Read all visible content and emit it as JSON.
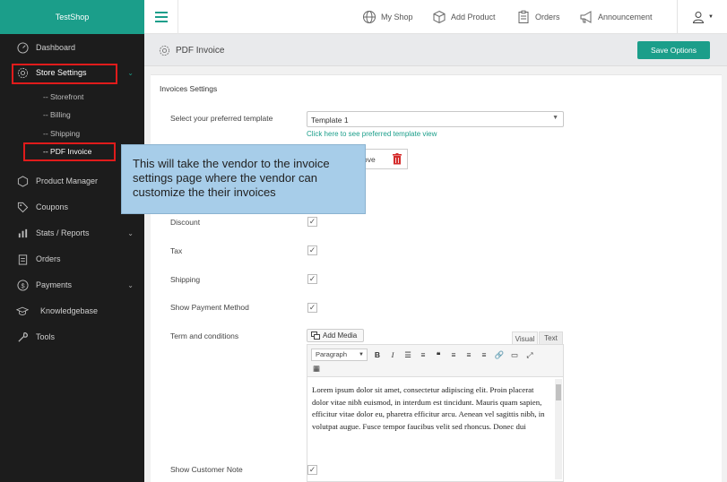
{
  "brand": "TestShop",
  "topnav": [
    {
      "label": "My Shop",
      "icon": "globe-icon"
    },
    {
      "label": "Add Product",
      "icon": "box-icon"
    },
    {
      "label": "Orders",
      "icon": "clipboard-icon"
    },
    {
      "label": "Announcement",
      "icon": "megaphone-icon"
    }
  ],
  "sidebar": {
    "items": [
      {
        "label": "Dashboard",
        "icon": "dashboard-icon"
      },
      {
        "label": "Store Settings",
        "icon": "gear-icon"
      },
      {
        "label": "Product Manager",
        "icon": "cube-icon"
      },
      {
        "label": "Coupons",
        "icon": "tag-icon"
      },
      {
        "label": "Stats / Reports",
        "icon": "chart-icon"
      },
      {
        "label": "Orders",
        "icon": "clipboard-icon"
      },
      {
        "label": "Payments",
        "icon": "dollar-icon"
      },
      {
        "label": "Knowledgebase",
        "icon": "graduation-cap-icon"
      },
      {
        "label": "Tools",
        "icon": "wrench-icon"
      }
    ],
    "sub_items": [
      "-- Storefront",
      "-- Billing",
      "-- Shipping",
      "-- PDF Invoice"
    ]
  },
  "page": {
    "title": "PDF Invoice",
    "save_label": "Save Options",
    "section_title": "Invoices Settings"
  },
  "form": {
    "template_label": "Select your preferred template",
    "template_value": "Template 1",
    "template_link": "Click here to see preferred template view",
    "remove_label": "ove",
    "rows": [
      {
        "label": "Discount",
        "checked": true
      },
      {
        "label": "Tax",
        "checked": true
      },
      {
        "label": "Shipping",
        "checked": true
      },
      {
        "label": "Show Payment Method",
        "checked": true
      }
    ],
    "terms_label": "Term and conditions",
    "add_media": "Add Media",
    "tab_visual": "Visual",
    "tab_text": "Text",
    "paragraph": "Paragraph",
    "editor_text": "Lorem ipsum dolor sit amet, consectetur adipiscing elit. Proin placerat dolor vitae nibh euismod, in interdum est tincidunt. Mauris quam sapien, efficitur vitae dolor eu, pharetra efficitur arcu. Aenean vel sagittis nibh, in volutpat augue. Fusce tempor faucibus velit sed rhoncus. Donec dui",
    "customer_note_label": "Show Customer Note",
    "customer_note_checked": true
  },
  "tooltip": "This will take the vendor to the invoice settings page where the vendor can customize the their invoices",
  "colors": {
    "brand": "#1b9e8a",
    "sidebar": "#1c1c1c",
    "highlight": "#e01b1b",
    "tooltip": "#a7cde9"
  }
}
